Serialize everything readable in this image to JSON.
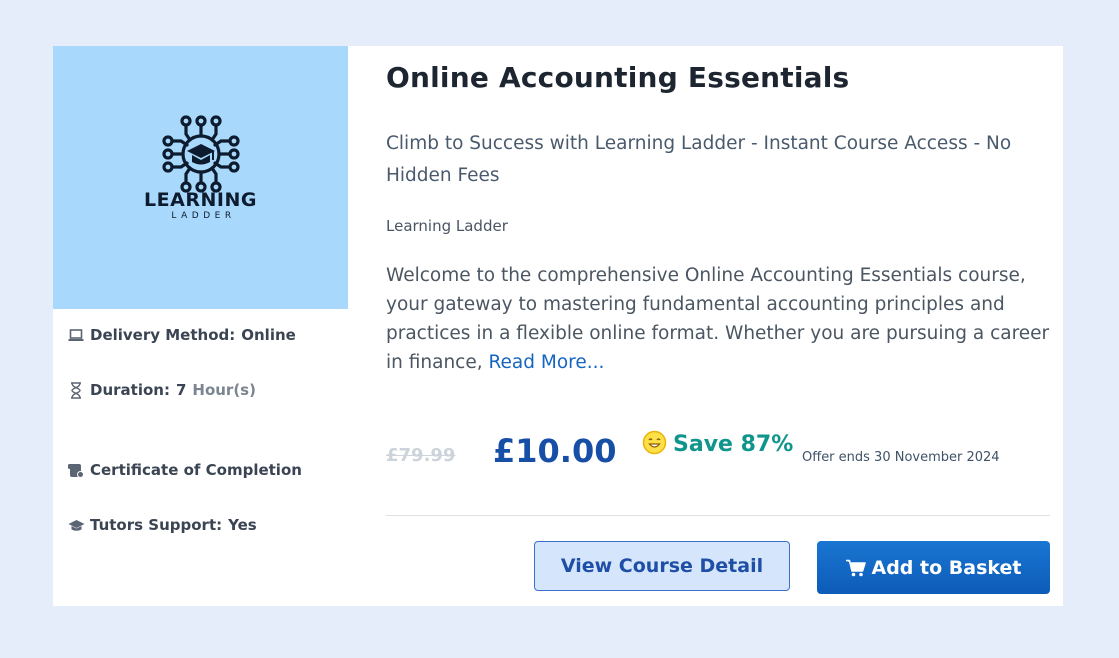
{
  "course": {
    "title": "Online Accounting Essentials",
    "subtitle": "Climb to Success with Learning Ladder - Instant Course Access - No Hidden Fees",
    "provider": "Learning Ladder",
    "description": "Welcome to the comprehensive Online Accounting Essentials course, your gateway to mastering fundamental accounting principles and practices in a flexible online format. Whether you are pursuing a career in finance, ",
    "read_more_label": "Read More..."
  },
  "logo": {
    "word": "LEARNING",
    "subword": "LADDER",
    "background": "#a9d8fd",
    "icon": "graduation-cap-network-icon"
  },
  "details": {
    "delivery": {
      "icon": "laptop-icon",
      "label": "Delivery Method:",
      "value": "Online"
    },
    "duration": {
      "icon": "hourglass-icon",
      "label": "Duration:",
      "value": "7",
      "unit": "Hour(s)"
    },
    "certificate": {
      "icon": "certificate-icon",
      "label": "Certificate of Completion"
    },
    "tutors": {
      "icon": "graduation-cap-icon",
      "label": "Tutors Support:",
      "value": "Yes"
    }
  },
  "pricing": {
    "old_price": "£79.99",
    "new_price": "£10.00",
    "save_icon": "smiley-icon",
    "save_text": "Save 87%",
    "offer_text": "Offer ends 30 November 2024"
  },
  "actions": {
    "detail_label": "View Course Detail",
    "basket_label": "Add to Basket",
    "basket_icon": "cart-icon"
  },
  "colors": {
    "page_background": "#e5edfb",
    "accent_blue": "#174ea6",
    "save_teal": "#10958c",
    "basket_button": "#1976d2"
  }
}
